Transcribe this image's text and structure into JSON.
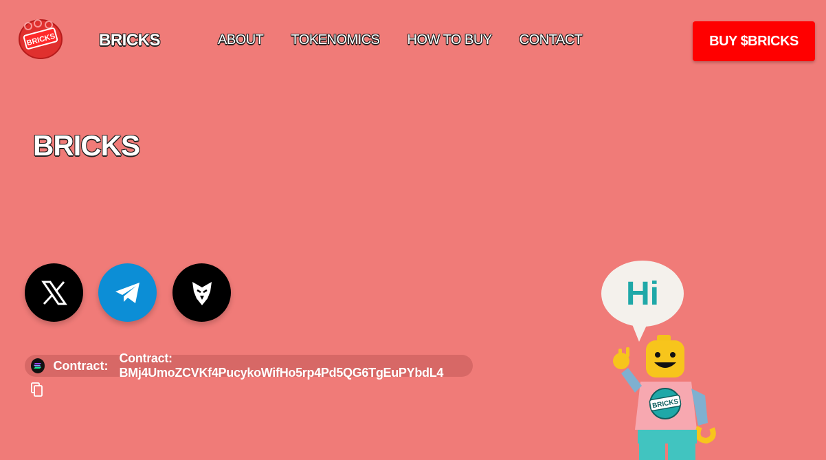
{
  "header": {
    "logo_text": "BRICKS",
    "brand": "BRICKS",
    "nav": [
      "ABOUT",
      "TOKENOMICS",
      "HOW TO BUY",
      "CONTACT"
    ],
    "buy_button": "BUY $BRICKS"
  },
  "hero": {
    "title": "BRICKS"
  },
  "socials": [
    {
      "icon": "x-icon"
    },
    {
      "icon": "telegram-icon"
    },
    {
      "icon": "eagle-icon"
    }
  ],
  "contract": {
    "label": "Contract:",
    "value": "Contract: BMj4UmoZCVKf4PucykoWifHo5rp4Pd5QG6TgEuPYbdL4"
  },
  "mascot": {
    "bubble_text": "Hi",
    "badge_text": "BRICKS"
  },
  "colors": {
    "background": "#f07b78",
    "buy_button": "#ff0000",
    "telegram": "#0c8ed6"
  }
}
